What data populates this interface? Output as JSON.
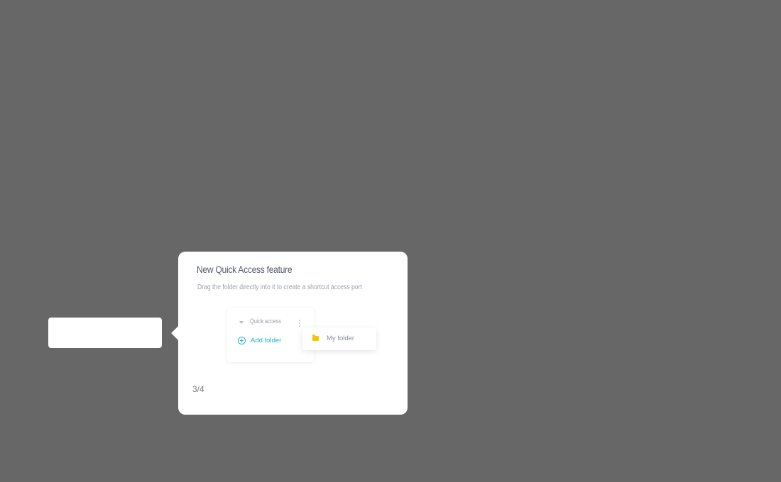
{
  "tour": {
    "title": "New Quick Access feature",
    "description": "Drag the folder directly into it to create a shortcut access port",
    "step": "3/4"
  },
  "illustration": {
    "quick_access_label": "Quick access",
    "add_folder_label": "Add folder",
    "folder_label": "My folder",
    "icons": {
      "caret": "caret-down-icon",
      "menu": "more-vertical-icon",
      "add": "plus-circle-icon",
      "folder": "folder-icon"
    }
  },
  "colors": {
    "overlay": "#676767",
    "accent": "#1fb3d8",
    "folder": "#f9c400"
  }
}
